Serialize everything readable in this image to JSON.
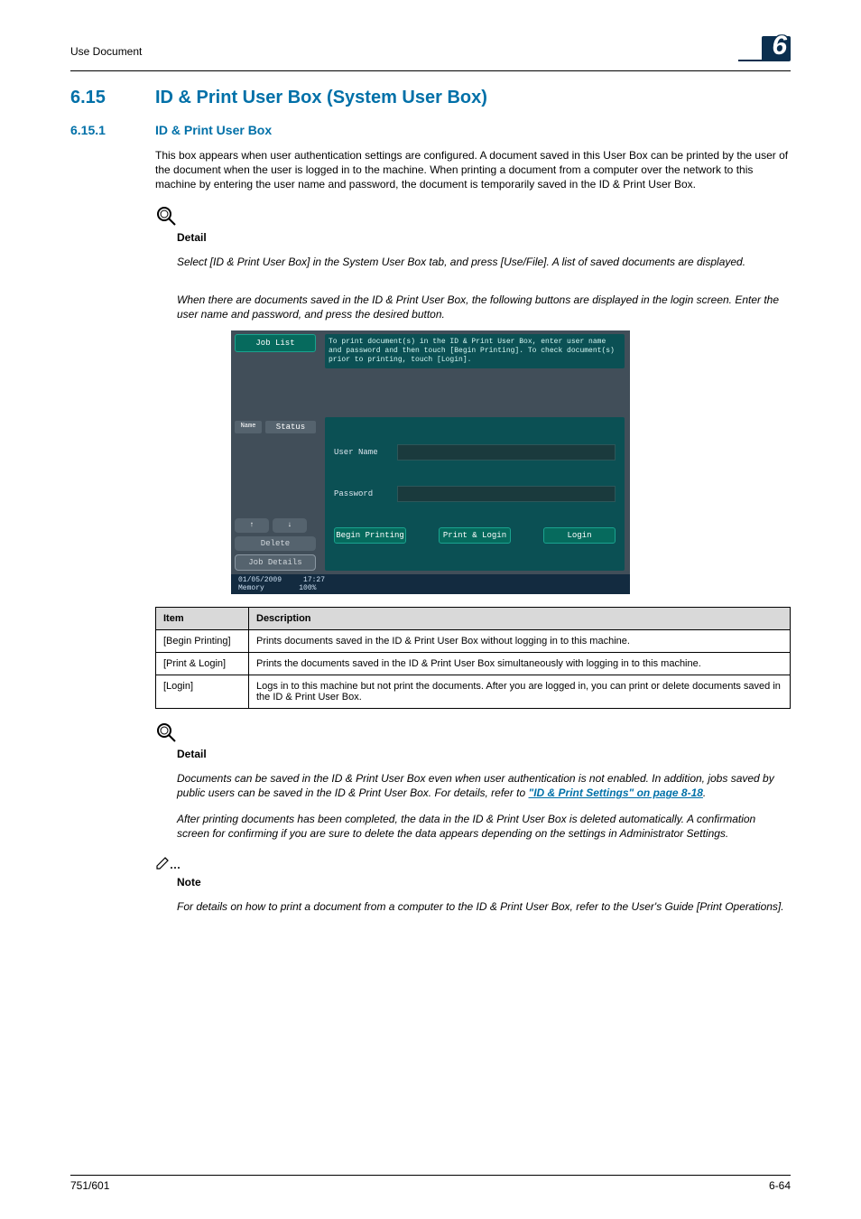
{
  "header": {
    "left": "Use Document",
    "chapter": "6"
  },
  "section": {
    "num": "6.15",
    "title": "ID & Print User Box (System User Box)"
  },
  "subsection": {
    "num": "6.15.1",
    "title": "ID & Print User Box"
  },
  "intro": "This box appears when user authentication settings are configured. A document saved in this User Box can be printed by the user of the document when the user is logged in to the machine. When printing a document from a computer over the network to this machine by entering the user name and password, the document is temporarily saved in the ID & Print User Box.",
  "detail1": {
    "label": "Detail",
    "p1": "Select [ID & Print User Box] in the System User Box tab, and press [Use/File]. A list of saved documents are displayed.",
    "p2": "When there are documents saved in the ID & Print User Box, the following buttons are displayed in the login screen. Enter the user name and password, and press the desired button."
  },
  "machine": {
    "job_list": "Job List",
    "instruction": "To print document(s) in the ID & Print User Box, enter user name and password and then touch [Begin Printing]. To check document(s) prior to printing, touch [Login].",
    "name_col": "Name",
    "status": "Status",
    "user_name_label": "User Name",
    "password_label": "Password",
    "delete": "Delete",
    "job_details": "Job Details",
    "begin_printing": "Begin Printing",
    "print_login": "Print & Login",
    "login": "Login",
    "footer_date": "01/05/2009",
    "footer_time": "17:27",
    "footer_mem_label": "Memory",
    "footer_mem_val": "100%"
  },
  "table": {
    "h1": "Item",
    "h2": "Description",
    "rows": [
      {
        "item": "[Begin Printing]",
        "desc": "Prints documents saved in the ID & Print User Box without logging in to this machine."
      },
      {
        "item": "[Print & Login]",
        "desc": "Prints the documents saved in the ID & Print User Box simultaneously with logging in to this machine."
      },
      {
        "item": "[Login]",
        "desc": "Logs in to this machine but not print the documents. After you are logged in, you can print or delete documents saved in the ID & Print User Box."
      }
    ]
  },
  "detail2": {
    "label": "Detail",
    "p1a": "Documents can be saved in the ID & Print User Box even when user authentication is not enabled. In addition, jobs saved by public users can be saved in the ID & Print User Box. For details, refer to ",
    "link": "\"ID & Print Settings\" on page 8-18",
    "p1b": ".",
    "p2": "After printing documents has been completed, the data in the ID & Print User Box is deleted automatically. A confirmation screen for confirming if you are sure to delete the data appears depending on the settings in Administrator Settings."
  },
  "note": {
    "label": "Note",
    "text": "For details on how to print a document from a computer to the ID & Print User Box, refer to the User's Guide [Print Operations]."
  },
  "footer": {
    "left": "751/601",
    "right": "6-64"
  }
}
